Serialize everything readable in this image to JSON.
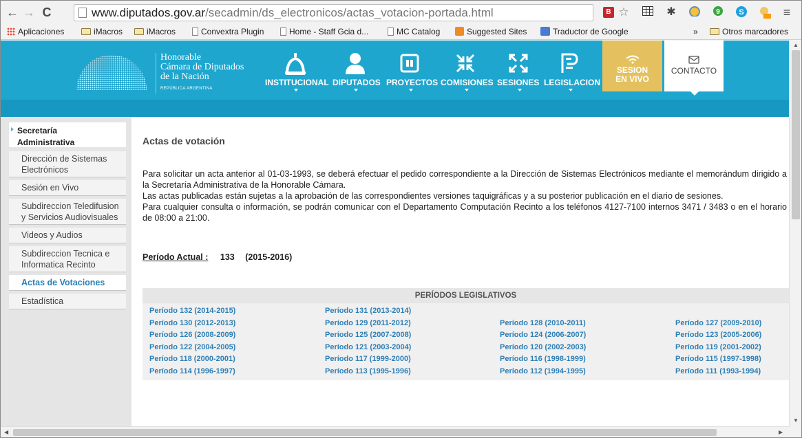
{
  "browser": {
    "url_host": "www.diputados.gov.ar",
    "url_path": "/secadmin/ds_electronicos/actas_votacion-portada.html",
    "bookmarks": [
      "Aplicaciones",
      "iMacros",
      "iMacros",
      "Convextra Plugin",
      "Home - Staff Gcia d...",
      "MC Catalog",
      "Suggested Sites",
      "Traductor de Google"
    ],
    "overflow_label": "»",
    "other_bookmarks": "Otros marcadores"
  },
  "site": {
    "brand_line1": "Honorable",
    "brand_line2": "Cámara de Diputados",
    "brand_line3": "de la Nación",
    "brand_sub": "REPÚBLICA ARGENTINA",
    "nav": [
      "INSTITUCIONAL",
      "DIPUTADOS",
      "PROYECTOS",
      "COMISIONES",
      "SESIONES",
      "LEGISLACION"
    ],
    "live_line1": "SESION",
    "live_line2": "EN VIVO",
    "contact": "CONTACTO"
  },
  "sidebar": {
    "header_line1": "Secretaría",
    "header_line2": "Administrativa",
    "items": [
      {
        "line1": "Dirección de Sistemas",
        "line2": "Electrónicos"
      },
      {
        "line1": "Sesión en Vivo",
        "line2": ""
      },
      {
        "line1": "Subdireccion Teledifusion",
        "line2": "y Servicios Audiovisuales"
      },
      {
        "line1": "Videos y Audios",
        "line2": ""
      },
      {
        "line1": "Subdireccion Tecnica e",
        "line2": "Informatica Recinto"
      },
      {
        "line1": "Actas de Votaciones",
        "line2": ""
      },
      {
        "line1": "Estadística",
        "line2": ""
      }
    ]
  },
  "main": {
    "title": "Actas de votación",
    "para1": "Para solicitar un acta anterior al 01-03-1993, se deberá efectuar el pedido correspondiente a la Dirección de Sistemas Electrónicos mediante el memorándum dirigido a la Secretaría Administrativa de la Honorable Cámara.",
    "para2": "Las actas publicadas están sujetas a la aprobación de las correspondientes versiones taquigráficas y a su posterior publicación en el diario de sesiones.",
    "para3": "Para cualquier consulta o información, se podrán comunicar con el Departamento Computación Recinto a los teléfonos 4127-7100 internos 3471 / 3483 o en el horario de 08:00 a 21:00.",
    "periodo_label": "Período Actual :",
    "periodo_num": "133",
    "periodo_years": "(2015-2016)",
    "table_header": "PERÍODOS LEGISLATIVOS",
    "periods": [
      [
        "Período 132 (2014-2015)",
        "Período 131 (2013-2014)",
        "",
        ""
      ],
      [
        "Período 130 (2012-2013)",
        "Período 129 (2011-2012)",
        "Período 128 (2010-2011)",
        "Período 127 (2009-2010)"
      ],
      [
        "Período 126 (2008-2009)",
        "Período 125 (2007-2008)",
        "Período 124 (2006-2007)",
        "Período 123 (2005-2006)"
      ],
      [
        "Período 122 (2004-2005)",
        "Período 121 (2003-2004)",
        "Período 120 (2002-2003)",
        "Período 119 (2001-2002)"
      ],
      [
        "Período 118 (2000-2001)",
        "Período 117 (1999-2000)",
        "Período 116 (1998-1999)",
        "Período 115 (1997-1998)"
      ],
      [
        "Período 114 (1996-1997)",
        "Período 113 (1995-1996)",
        "Período 112 (1994-1995)",
        "Período 111 (1993-1994)"
      ]
    ]
  }
}
